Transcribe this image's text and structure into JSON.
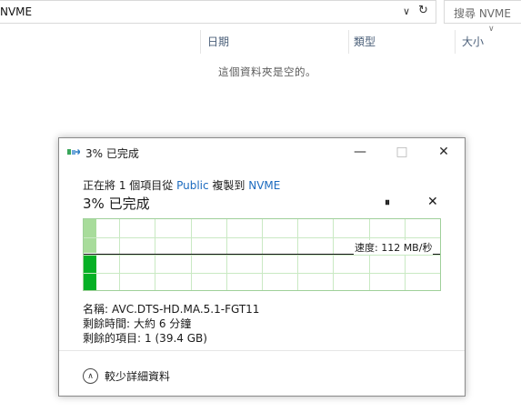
{
  "explorer": {
    "address": "NVME",
    "search_placeholder": "搜尋 NVME",
    "columns": {
      "date": "日期",
      "type": "類型",
      "size": "大小"
    },
    "empty_message": "這個資料夾是空的。"
  },
  "dialog": {
    "title": "3% 已完成",
    "line1": {
      "prefix": "正在將 1 個項目從 ",
      "source": "Public",
      "middle": " 複製到 ",
      "destination": "NVME"
    },
    "headline": "3% 已完成",
    "pause_symbol": "⏸",
    "cancel_symbol": "✕",
    "speed_text": "速度: 112 MB/秒",
    "info": {
      "name_label": "名稱:",
      "name_value": "AVC.DTS-HD.MA.5.1-FGT11",
      "time_label": "剩餘時間:",
      "time_value": "大約 6 分鐘",
      "items_label": "剩餘的項目:",
      "items_value": "1 (39.4 GB)"
    },
    "details_toggle": "較少詳細資料"
  },
  "progress": {
    "percent": 3
  },
  "colors": {
    "accent_link": "#1c6bbf",
    "graph_fill_dark": "#06b025",
    "graph_fill_light": "#a8dc9b",
    "graph_grid": "#c9e9c3"
  }
}
